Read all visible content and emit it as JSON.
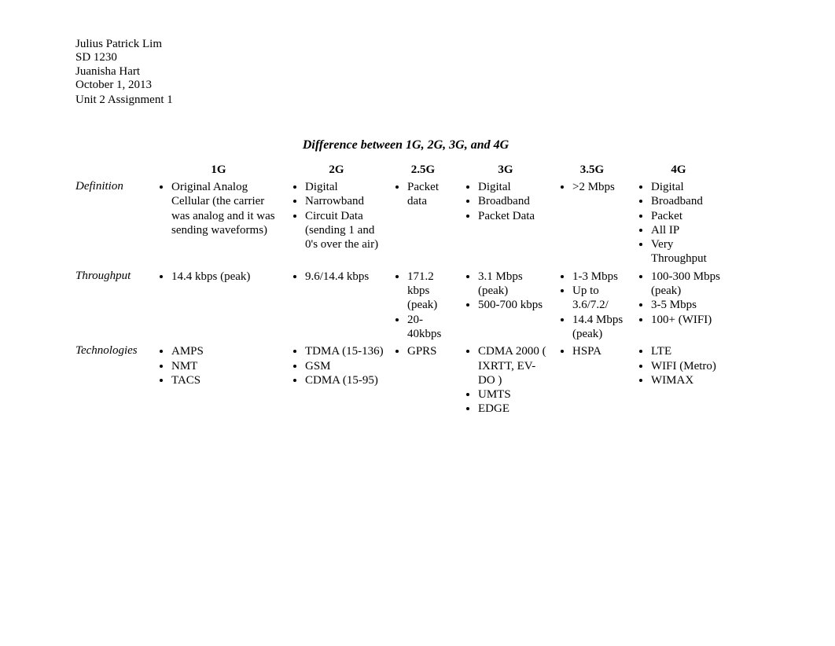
{
  "meta": {
    "name": "Julius Patrick Lim",
    "course": "SD 1230",
    "instructor": "Juanisha Hart",
    "date": "October 1, 2013",
    "assignment": "Unit 2 Assignment 1"
  },
  "title": "Difference between 1G, 2G, 3G, and 4G",
  "columns": [
    "1G",
    "2G",
    "2.5G",
    "3G",
    "3.5G",
    "4G"
  ],
  "rows": [
    {
      "label": "Definition",
      "cells": [
        [
          "Original Analog Cellular (the carrier was analog and it was sending waveforms)"
        ],
        [
          "Digital",
          "Narrowband",
          "Circuit Data (sending 1 and 0's over the air)"
        ],
        [
          "Packet data"
        ],
        [
          "Digital",
          "Broadband",
          "Packet Data"
        ],
        [
          ">2 Mbps"
        ],
        [
          "Digital",
          "Broadband",
          "Packet",
          "All IP",
          "Very Throughput"
        ]
      ]
    },
    {
      "label": "Throughput",
      "cells": [
        [
          "14.4 kbps (peak)"
        ],
        [
          "9.6/14.4 kbps"
        ],
        [
          "171.2 kbps (peak)",
          "20-40kbps"
        ],
        [
          "3.1 Mbps (peak)",
          "500-700 kbps"
        ],
        [
          "1-3 Mbps",
          "Up to 3.6/7.2/",
          "14.4 Mbps (peak)"
        ],
        [
          "100-300 Mbps (peak)",
          "3-5 Mbps",
          "100+ (WIFI)"
        ]
      ]
    },
    {
      "label": "Technologies",
      "cells": [
        [
          "AMPS",
          "NMT",
          "TACS"
        ],
        [
          "TDMA (15-136)",
          "GSM",
          "CDMA (15-95)"
        ],
        [
          "GPRS"
        ],
        [
          "CDMA 2000 ( IXRTT, EV-DO )",
          "UMTS",
          "EDGE"
        ],
        [
          "HSPA"
        ],
        [
          "LTE",
          "WIFI (Metro)",
          "WIMAX"
        ]
      ]
    }
  ]
}
